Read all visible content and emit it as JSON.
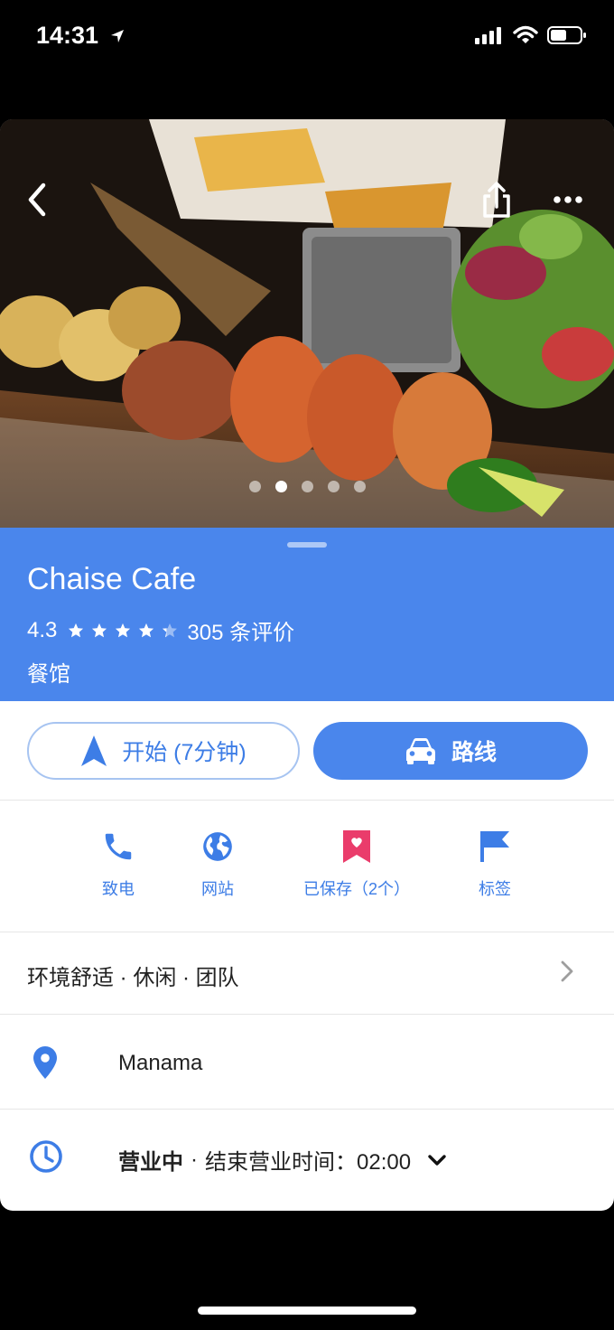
{
  "status_bar": {
    "time": "14:31"
  },
  "hero": {
    "photo_count": 5,
    "active_photo_index": 1
  },
  "place": {
    "name": "Chaise Cafe",
    "rating": "4.3",
    "stars_value": 4.3,
    "reviews": "305 条评价",
    "type": "餐馆"
  },
  "actions": {
    "start_label": "开始 (7分钟)",
    "route_label": "路线"
  },
  "quick_actions": [
    {
      "label": "致电",
      "icon": "phone-icon"
    },
    {
      "label": "网站",
      "icon": "globe-icon"
    },
    {
      "label": "已保存（2个）",
      "icon": "saved-bookmark-icon"
    },
    {
      "label": "标签",
      "icon": "flag-icon"
    }
  ],
  "attributes": "环境舒适 · 休闲 · 团队",
  "address": "Manama",
  "hours": {
    "status": "营业中",
    "separator": "·",
    "close_text": "结束营业时间：02:00"
  },
  "colors": {
    "accent": "#4a86ec",
    "link": "#3d7de6",
    "saved": "#ea3c6b"
  }
}
